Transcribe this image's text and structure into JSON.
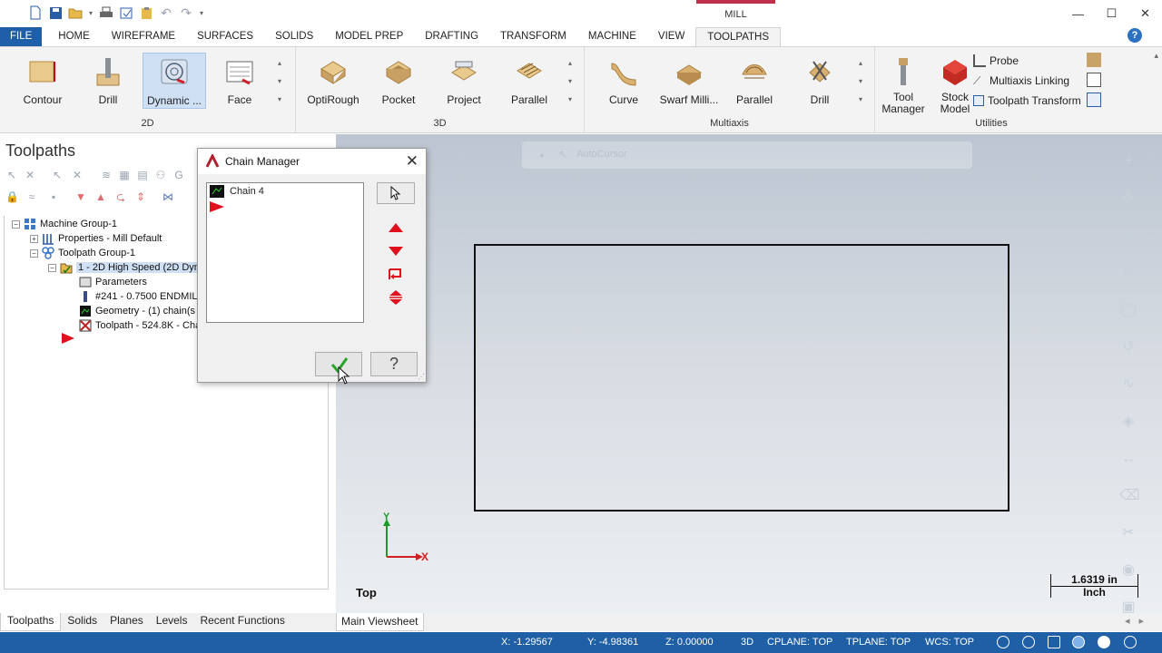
{
  "context_tab": "MILL",
  "ribbon_tabs": [
    "FILE",
    "HOME",
    "WIREFRAME",
    "SURFACES",
    "SOLIDS",
    "MODEL PREP",
    "DRAFTING",
    "TRANSFORM",
    "MACHINE",
    "VIEW",
    "TOOLPATHS"
  ],
  "active_tab": "TOOLPATHS",
  "groups": {
    "g2d": {
      "label": "2D",
      "buttons": [
        "Contour",
        "Drill",
        "Dynamic ...",
        "Face"
      ]
    },
    "g3d": {
      "label": "3D",
      "buttons": [
        "OptiRough",
        "Pocket",
        "Project",
        "Parallel"
      ]
    },
    "multiaxis": {
      "label": "Multiaxis",
      "buttons": [
        "Curve",
        "Swarf Milli...",
        "Parallel",
        "Drill"
      ]
    },
    "utilities": {
      "label": "Utilities",
      "tool_manager": "Tool Manager",
      "stock_model": "Stock Model",
      "probe": "Probe",
      "multiaxis_linking": "Multiaxis Linking",
      "toolpath_transform": "Toolpath Transform"
    }
  },
  "left_panel": {
    "title": "Toolpaths",
    "tree": {
      "machine_group": "Machine Group-1",
      "properties": "Properties - Mill Default",
      "toolpath_group": "Toolpath Group-1",
      "operation": "1 - 2D High Speed (2D Dyna",
      "parameters": "Parameters",
      "tool": "#241 - 0.7500 ENDMILL",
      "geometry": "Geometry -  (1) chain(s",
      "toolpath": "Toolpath - 524.8K - Cha"
    },
    "bottom_tabs": [
      "Toolpaths",
      "Solids",
      "Planes",
      "Levels",
      "Recent Functions"
    ]
  },
  "dialog": {
    "title": "Chain Manager",
    "chain_item": "Chain 4"
  },
  "viewport": {
    "autocursor": "AutoCursor",
    "view_label": "Top",
    "scale_value": "1.6319 in",
    "scale_unit": "Inch",
    "axis_x": "X",
    "axis_y": "Y",
    "sheet_tab": "Main Viewsheet"
  },
  "status": {
    "x": "X:   -1.29567",
    "y": "Y:   -4.98361",
    "z": "Z:   0.00000",
    "mode": "3D",
    "cplane": "CPLANE: TOP",
    "tplane": "TPLANE: TOP",
    "wcs": "WCS: TOP"
  },
  "colors": {
    "file_tab": "#1f5fa8",
    "status_bar": "#1e5fa5",
    "context_accent": "#c0304a",
    "chain_arrow": "#e0101e"
  }
}
